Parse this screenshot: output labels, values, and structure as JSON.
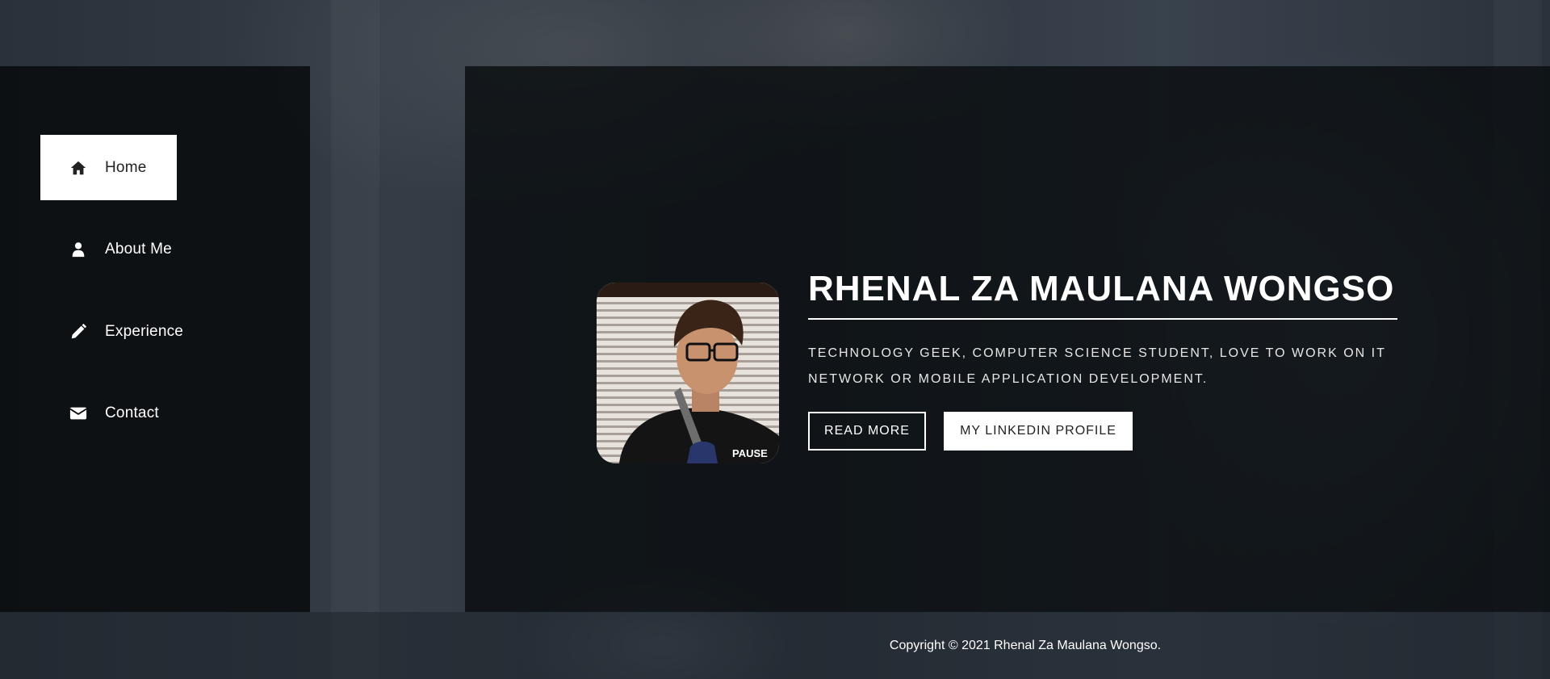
{
  "nav": {
    "items": [
      {
        "label": "Home",
        "icon": "home-icon",
        "active": true
      },
      {
        "label": "About Me",
        "icon": "user-icon",
        "active": false
      },
      {
        "label": "Experience",
        "icon": "pencil-icon",
        "active": false
      },
      {
        "label": "Contact",
        "icon": "envelope-icon",
        "active": false
      }
    ]
  },
  "hero": {
    "name": "RHENAL ZA MAULANA WONGSO",
    "tagline": "TECHNOLOGY GEEK, COMPUTER SCIENCE STUDENT, LOVE TO WORK ON IT NETWORK OR MOBILE APPLICATION DEVELOPMENT.",
    "read_more_label": "READ MORE",
    "linkedin_label": "MY LINKEDIN PROFILE",
    "shirt_text": "PAUSE"
  },
  "footer": {
    "copyright": "Copyright © 2021 Rhenal Za Maulana Wongso."
  },
  "colors": {
    "panel": "#0a0d10",
    "accent": "#ffffff"
  }
}
